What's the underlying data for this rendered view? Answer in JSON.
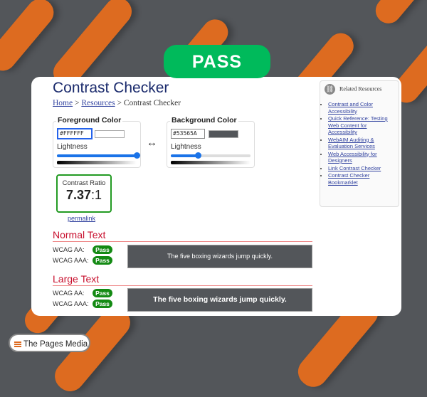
{
  "banner": {
    "label": "PASS"
  },
  "page": {
    "title": "Contrast Checker",
    "breadcrumb": [
      {
        "label": "Home"
      },
      {
        "sep": ">"
      },
      {
        "label": "Resources"
      },
      {
        "current": "Contrast Checker"
      }
    ]
  },
  "foreground": {
    "legend": "Foreground Color",
    "hex": "#FFFFFF",
    "swatch_color": "#FFFFFF",
    "lightness_label": "Lightness",
    "lightness_percent": 100
  },
  "swap_icon": "↔",
  "background": {
    "legend": "Background Color",
    "hex": "#53565A",
    "swatch_color": "#53565A",
    "lightness_percent": 34,
    "lightness_label": "Lightness"
  },
  "ratio": {
    "label": "Contrast Ratio",
    "value": "7.37",
    "suffix": ":1",
    "permalink": "permalink"
  },
  "normal_text": {
    "heading": "Normal Text",
    "aa_label": "WCAG AA:",
    "aa_result": "Pass",
    "aaa_label": "WCAG AAA:",
    "aaa_result": "Pass",
    "sample": "The five boxing wizards jump quickly."
  },
  "large_text": {
    "heading": "Large Text",
    "aa_label": "WCAG AA:",
    "aa_result": "Pass",
    "aaa_label": "WCAG AAA:",
    "aaa_result": "Pass",
    "sample": "The five boxing wizards jump quickly."
  },
  "related": {
    "heading": "Related Resources",
    "links": [
      "Contrast and Color Accessibility",
      "Quick Reference: Testing Web Content for Accessibility",
      "WebAIM Auditing & Evaluation Services",
      "Web Accessibility for Designers",
      "Link Contrast Checker",
      "Contrast Checker Bookmarklet"
    ]
  },
  "brand": {
    "name": "The Pages Media"
  },
  "colors": {
    "pass_green": "#00BA5B",
    "badge_green": "#138A13",
    "accent_orange": "#DD6B20",
    "heading_red": "#C8102E"
  }
}
